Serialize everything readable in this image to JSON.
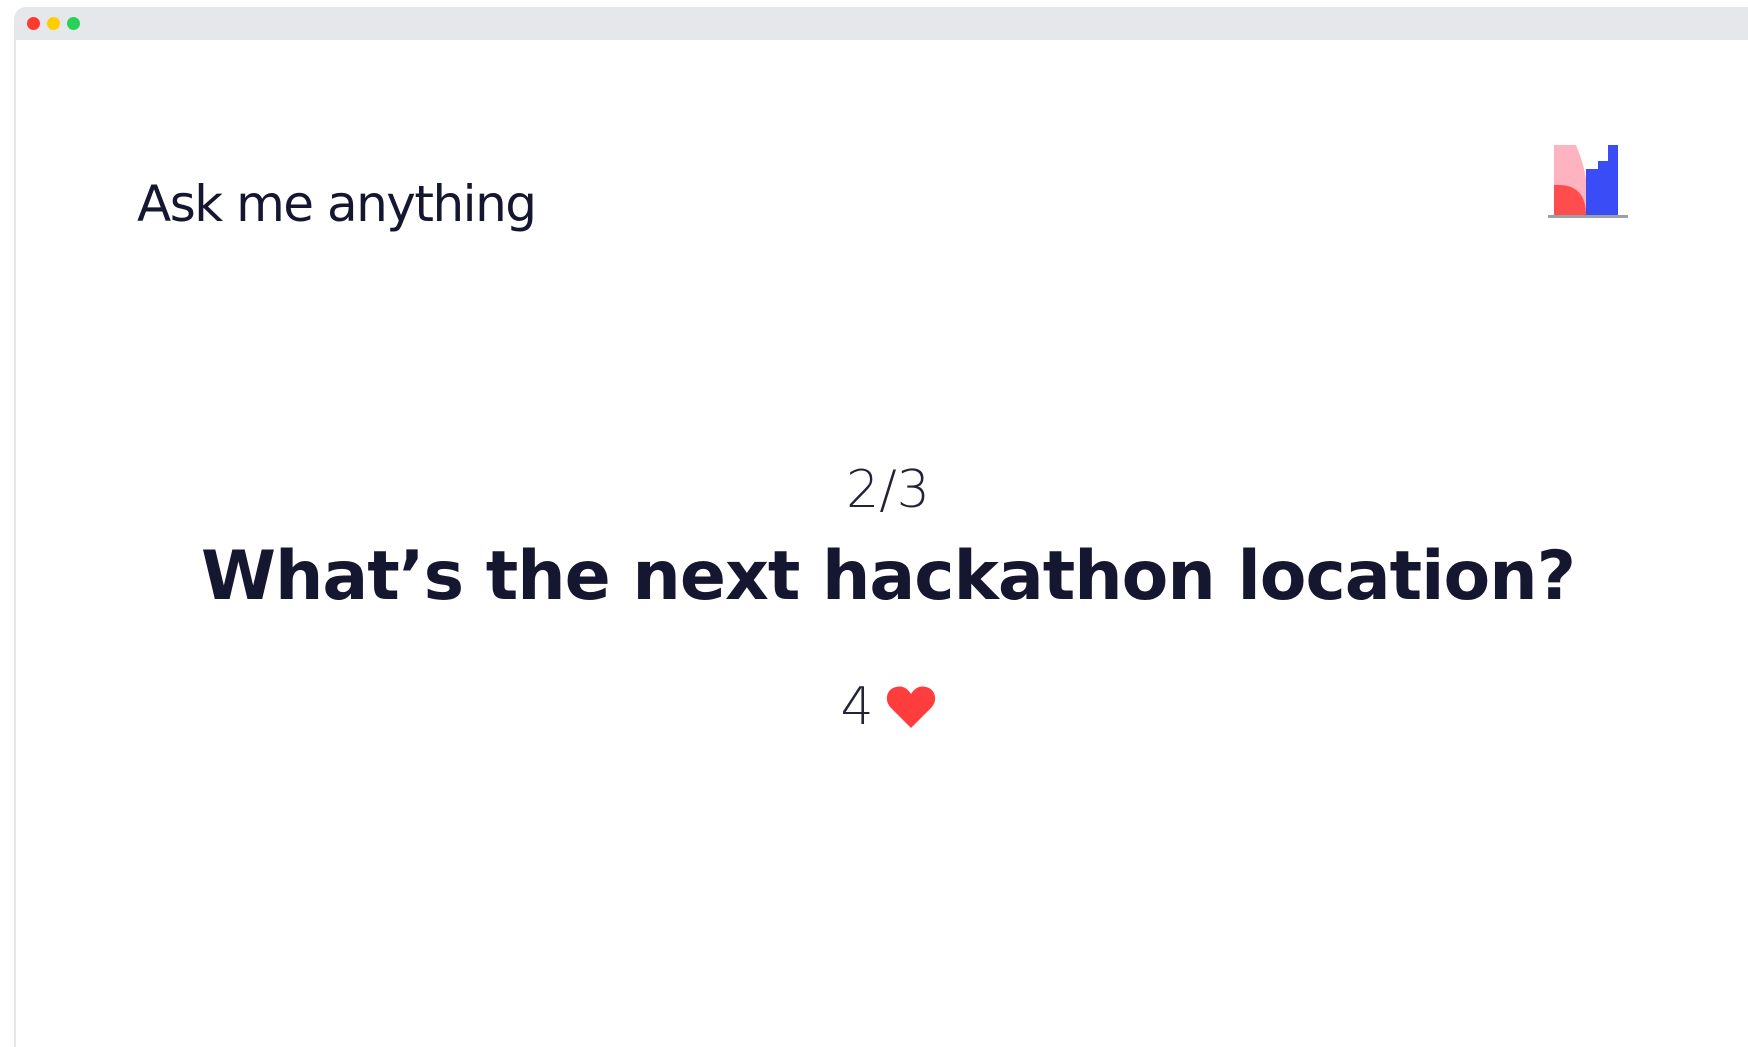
{
  "window": {
    "controls": [
      {
        "name": "close",
        "color": "#ff3b30"
      },
      {
        "name": "minimize",
        "color": "#ffcc00"
      },
      {
        "name": "zoom",
        "color": "#2ad158"
      }
    ]
  },
  "slide": {
    "title": "Ask me anything",
    "counter": "2/3",
    "question": "What’s the next hackathon location?",
    "likes": "4",
    "likes_icon": "heart-icon",
    "heart_color": "#ff3d3d",
    "text_color": "#151630"
  },
  "logo": {
    "icon": "mentimeter-logo-icon",
    "colors": [
      "#ff9fb1",
      "#ff4d4d",
      "#3a4cf5"
    ]
  }
}
